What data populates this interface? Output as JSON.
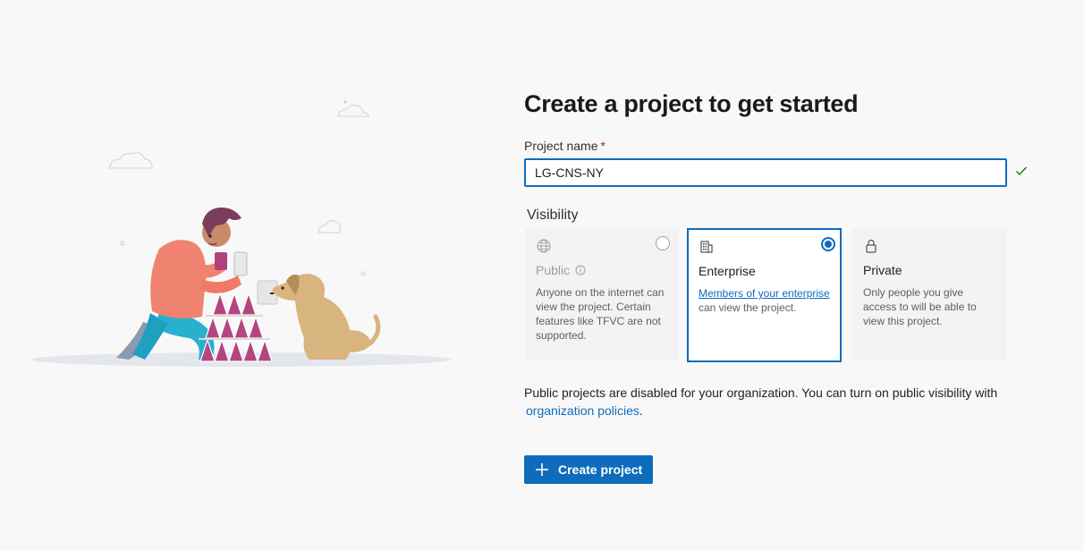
{
  "form": {
    "title": "Create a project to get started",
    "project_name_label": "Project name",
    "required_marker": "*",
    "project_name_value": "LG-CNS-NY",
    "visibility_label": "Visibility"
  },
  "visibility_options": {
    "public": {
      "title": "Public",
      "description": "Anyone on the internet can view the project. Certain features like TFVC are not supported.",
      "icon": "globe-icon",
      "selected": false,
      "disabled": true
    },
    "enterprise": {
      "title": "Enterprise",
      "link_text": "Members of your enterprise",
      "description_suffix": " can view the project.",
      "icon": "building-icon",
      "selected": true
    },
    "private": {
      "title": "Private",
      "description": "Only people you give access to will be able to view this project.",
      "icon": "lock-icon",
      "selected": false
    }
  },
  "info": {
    "text": "Public projects are disabled for your organization. You can turn on public visibility with",
    "link_text": "organization policies",
    "suffix": "."
  },
  "actions": {
    "create_label": "Create project"
  },
  "colors": {
    "accent": "#0f6cbd",
    "success": "#107c10",
    "required": "#a4262c",
    "background": "#f8f8f8"
  }
}
